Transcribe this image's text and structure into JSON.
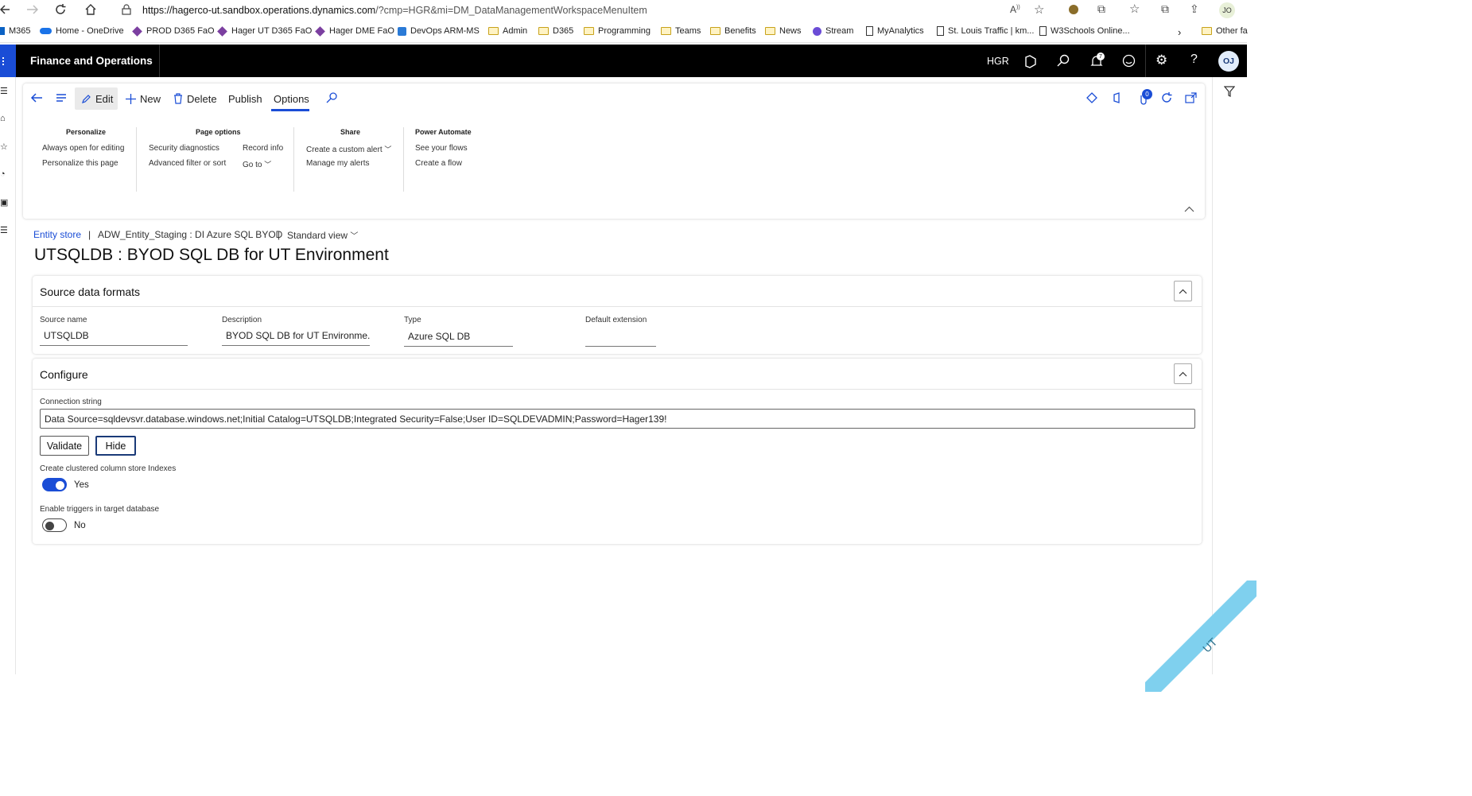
{
  "browser": {
    "url_host": "https://hagerco-ut.sandbox.operations.dynamics.com",
    "url_path": "/?cmp=HGR&mi=DM_DataManagementWorkspaceMenuItem",
    "profile": "JO"
  },
  "favorites": [
    {
      "label": "M365",
      "icon": "m365-icon"
    },
    {
      "label": "Home - OneDrive",
      "icon": "onedrive-icon"
    },
    {
      "label": "PROD D365 FaO",
      "icon": "d365-icon"
    },
    {
      "label": "Hager UT D365 FaO",
      "icon": "d365-icon"
    },
    {
      "label": "Hager DME FaO",
      "icon": "d365-icon"
    },
    {
      "label": "DevOps ARM-MS",
      "icon": "devops-icon"
    },
    {
      "label": "Admin",
      "icon": "folder-icon"
    },
    {
      "label": "D365",
      "icon": "folder-icon"
    },
    {
      "label": "Programming",
      "icon": "folder-icon"
    },
    {
      "label": "Teams",
      "icon": "folder-icon"
    },
    {
      "label": "Benefits",
      "icon": "folder-icon"
    },
    {
      "label": "News",
      "icon": "folder-icon"
    },
    {
      "label": "Stream",
      "icon": "stream-icon"
    },
    {
      "label": "MyAnalytics",
      "icon": "page-icon"
    },
    {
      "label": "St. Louis Traffic | km...",
      "icon": "page-icon"
    },
    {
      "label": "W3Schools Online...",
      "icon": "page-icon"
    },
    {
      "label": "Other fa",
      "icon": "folder-icon"
    }
  ],
  "app": {
    "title": "Finance and Operations",
    "company": "HGR",
    "avatar": "OJ",
    "notification_count": "7"
  },
  "action_pane": {
    "edit": "Edit",
    "new": "New",
    "delete": "Delete",
    "publish": "Publish",
    "options": "Options",
    "attachments_count": "0",
    "groups": {
      "personalize": {
        "title": "Personalize",
        "items": [
          "Always open for editing",
          "Personalize this page"
        ]
      },
      "page_options": {
        "title": "Page options",
        "col1": [
          "Security diagnostics",
          "Advanced filter or sort"
        ],
        "col2": [
          "Record info",
          "Go to"
        ]
      },
      "share": {
        "title": "Share",
        "items": [
          "Create a custom alert",
          "Manage my alerts"
        ]
      },
      "power_automate": {
        "title": "Power Automate",
        "items": [
          "See your flows",
          "Create a flow"
        ]
      }
    }
  },
  "breadcrumb": {
    "link": "Entity store",
    "context": "ADW_Entity_Staging : DI Azure SQL BYOD",
    "view": "Standard view"
  },
  "page_title": "UTSQLDB : BYOD SQL DB for UT Environment",
  "source_data_formats": {
    "header": "Source data formats",
    "fields": [
      {
        "label": "Source name",
        "value": "UTSQLDB"
      },
      {
        "label": "Description",
        "value": "BYOD SQL DB for UT Environme..."
      },
      {
        "label": "Type",
        "value": "Azure SQL DB"
      },
      {
        "label": "Default extension",
        "value": ""
      }
    ]
  },
  "configure": {
    "header": "Configure",
    "connection_string_label": "Connection string",
    "connection_string": "Data Source=sqldevsvr.database.windows.net;Initial Catalog=UTSQLDB;Integrated Security=False;User ID=SQLDEVADMIN;Password=Hager139!",
    "validate": "Validate",
    "hide": "Hide",
    "clustered_label": "Create clustered column store Indexes",
    "clustered_value": "Yes",
    "clustered_on": true,
    "triggers_label": "Enable triggers in target database",
    "triggers_value": "No",
    "triggers_on": false
  },
  "environment_badge": "UT",
  "colors": {
    "accent": "#1a4dd6",
    "header_bg": "#000000",
    "toggle_on": "#1a4dd6",
    "badge": "#7fd0ee"
  }
}
